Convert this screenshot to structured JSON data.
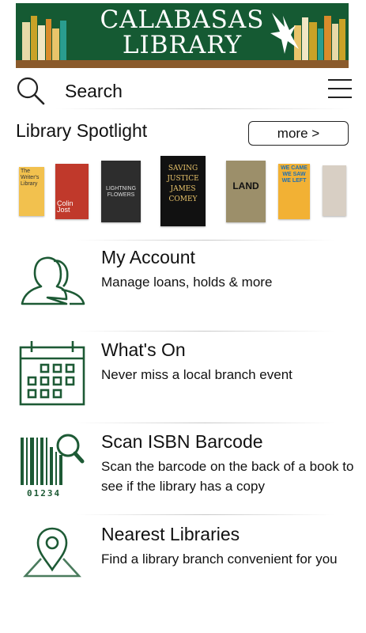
{
  "banner": {
    "line1": "CALABASAS",
    "line2": "LIBRARY"
  },
  "search": {
    "label": "Search"
  },
  "spotlight": {
    "title": "Library Spotlight",
    "more_label": "more >",
    "covers": [
      {
        "text": "The Writer's Library"
      },
      {
        "text": "Colin Jost"
      },
      {
        "text": "LIGHTNING FLOWERS"
      },
      {
        "text": "SAVING JUSTICE JAMES COMEY"
      },
      {
        "text": "LAND"
      },
      {
        "text": "WE CAME WE SAW WE LEFT"
      },
      {
        "text": ""
      }
    ]
  },
  "menu": [
    {
      "label": "My Account",
      "desc": "Manage loans, holds & more",
      "icon": "users-icon"
    },
    {
      "label": "What's On",
      "desc": "Never miss a local branch event",
      "icon": "calendar-icon"
    },
    {
      "label": "Scan ISBN Barcode",
      "desc": "Scan the barcode on the back of a book to see if the library has a copy",
      "icon": "barcode-icon",
      "barcode_digits": "01234"
    },
    {
      "label": "Nearest Libraries",
      "desc": "Find a library branch convenient for you",
      "icon": "map-pin-icon"
    }
  ],
  "colors": {
    "brand_green": "#155a33",
    "shelf_brown": "#8a5a2b"
  }
}
